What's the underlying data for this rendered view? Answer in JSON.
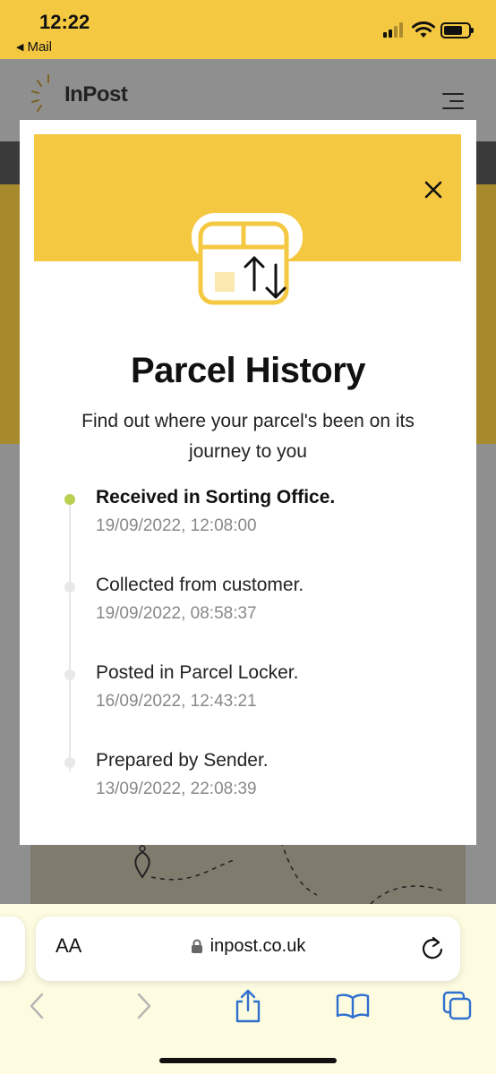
{
  "status_bar": {
    "time": "12:22",
    "back_app": "Mail"
  },
  "site": {
    "logo_text": "InPost"
  },
  "modal": {
    "title": "Parcel History",
    "subtitle": "Find out where your parcel's been on its journey to you",
    "events": [
      {
        "title": "Received in Sorting Office.",
        "time": "19/09/2022, 12:08:00",
        "active": true
      },
      {
        "title": "Collected from customer.",
        "time": "19/09/2022, 08:58:37",
        "active": false
      },
      {
        "title": "Posted in Parcel Locker.",
        "time": "16/09/2022, 12:43:21",
        "active": false
      },
      {
        "title": "Prepared by Sender.",
        "time": "13/09/2022, 22:08:39",
        "active": false
      }
    ]
  },
  "browser": {
    "text_size_label": "AA",
    "url": "inpost.co.uk"
  },
  "colors": {
    "brand_yellow": "#f5c842",
    "active_dot": "#b9cf4f",
    "link_blue": "#2f6fd0"
  }
}
